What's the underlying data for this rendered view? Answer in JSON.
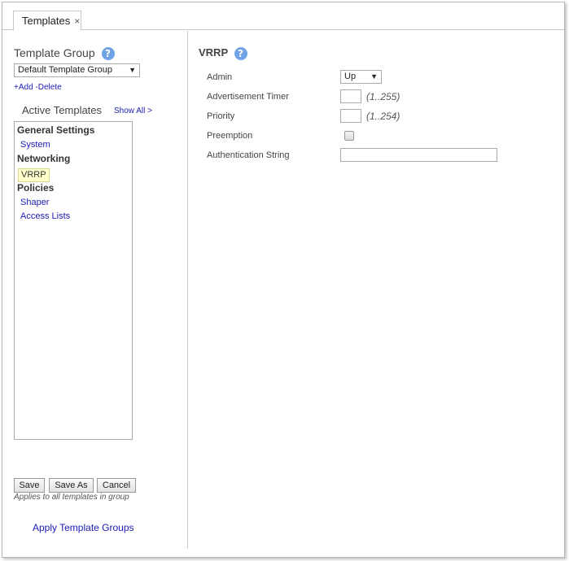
{
  "tab": {
    "label": "Templates",
    "close_glyph": "×"
  },
  "left": {
    "template_group_title": "Template Group",
    "help_glyph": "?",
    "template_group_selected": "Default Template Group",
    "add_link": "+Add",
    "delete_link": "-Delete",
    "active_templates_title": "Active Templates",
    "show_all_link": "Show All >",
    "templates": {
      "general_settings": "General Settings",
      "system": "System",
      "networking": "Networking",
      "vrrp": "VRRP",
      "policies": "Policies",
      "shaper": "Shaper",
      "access_lists": "Access Lists"
    },
    "buttons": {
      "save": "Save",
      "save_as": "Save As",
      "cancel": "Cancel"
    },
    "applies_note": "Applies to all templates in group",
    "apply_template_groups": "Apply Template Groups"
  },
  "vrrp": {
    "title": "VRRP",
    "help_glyph": "?",
    "admin_label": "Admin",
    "admin_value": "Up",
    "adv_timer_label": "Advertisement Timer",
    "adv_timer_value": "",
    "adv_timer_range": "(1..255)",
    "priority_label": "Priority",
    "priority_value": "",
    "priority_range": "(1..254)",
    "preemption_label": "Preemption",
    "preemption_checked": false,
    "auth_label": "Authentication String",
    "auth_value": ""
  },
  "icons": {
    "help": "help-icon",
    "dropdown": "dropdown-arrow-icon",
    "close": "close-icon"
  },
  "colors": {
    "link": "#1a1ab2",
    "help": "#6fa3e6",
    "selected_bg": "#ffffcc"
  }
}
